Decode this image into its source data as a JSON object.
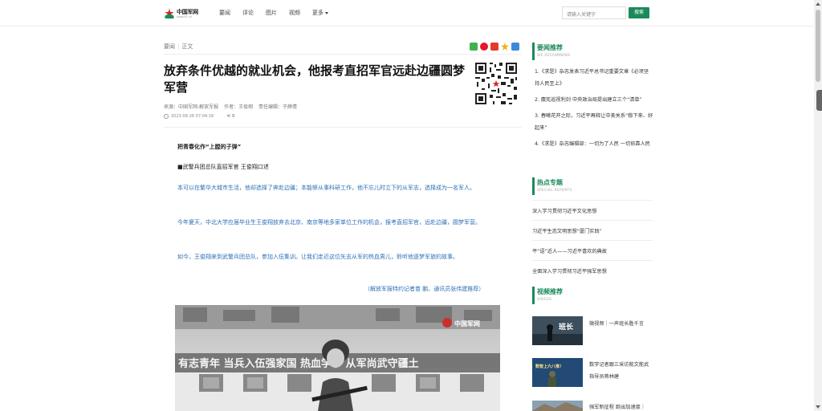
{
  "header": {
    "logo_text": "中国军网",
    "logo_sub": "www.81.cn",
    "nav": [
      "要闻",
      "评论",
      "图片",
      "视频",
      "更多"
    ],
    "search_placeholder": "请输入关键字",
    "search_button": "搜索"
  },
  "breadcrumb": [
    "要闻",
    "正文"
  ],
  "article": {
    "title": "放弃条件优越的就业机会，他报考直招军官远赴边疆圆梦军营",
    "source": "来源：中国军网-解放军报",
    "author": "作者：王俊翔",
    "editor": "责任编辑：于薛倩",
    "datetime": "2023-08-26 07:04:18",
    "share_count": "0",
    "heading": "把青春化作“上膛的子弹”",
    "byline": "■武警兵团总队直招军官  王俊翔口述",
    "paragraphs": [
      "本可以在繁华大城市生活，他却选择了奔赴边疆；本能够从事科研工作，他不忘儿时立下的从军志，选择成为一名军人。",
      "今年夏天，中北大学应届毕业生王俊翔放弃去北京、南京等地多家单位工作的机会，报考直招军官，远赴边疆，圆梦军营。",
      "如今，王俊翔来到武警兵团总队，参加入伍集训。让我们走近这位矢志从军的热血男儿，聆听他逐梦军旅的故事。"
    ],
    "credit": "（解放军报特约记者苗  鹏、通讯员张伟建推荐）",
    "photo_banner": "有志青年  当兵入伍强家国  热血学子  从军尚武守疆土",
    "photo_logo": "中国军网"
  },
  "sidebar": {
    "recommend": {
      "title": "要闻推荐",
      "subtitle": "WE RECOMMEND",
      "items": [
        "1.《求是》杂志发表习近平总书记重要文章《必须坚持人民至上》",
        "2. 麋宪巡视利剑 中央政治局提出建立三个“清单”",
        "3. 春曦花开之际，习近平再释让中美关系“稳下来、好起来”",
        "4.《求是》杂志编辑部：一切为了人民 一切依靠人民"
      ]
    },
    "hot": {
      "title": "热点专题",
      "subtitle": "SPECIAL REPORTS",
      "items": [
        "深入学习贯彻习近平文化思想",
        "习近平生态文明思想“厦门实践”",
        "平“语”近人——习近平喜欢的典故",
        "全面深入学习贯彻习近平强军思想"
      ]
    },
    "videos": {
      "title": "视频推荐",
      "subtitle": "VIDEOS",
      "items": [
        {
          "text": "微视频｜一声班长胜千言",
          "thumb_text": "班长"
        },
        {
          "text": "数字记者跟三采访能文能武指导员蒋林建",
          "thumb_text": "数智上六八推！"
        },
        {
          "text": "强军新征程 跑出加速度｜",
          "thumb_text": ""
        }
      ]
    }
  }
}
